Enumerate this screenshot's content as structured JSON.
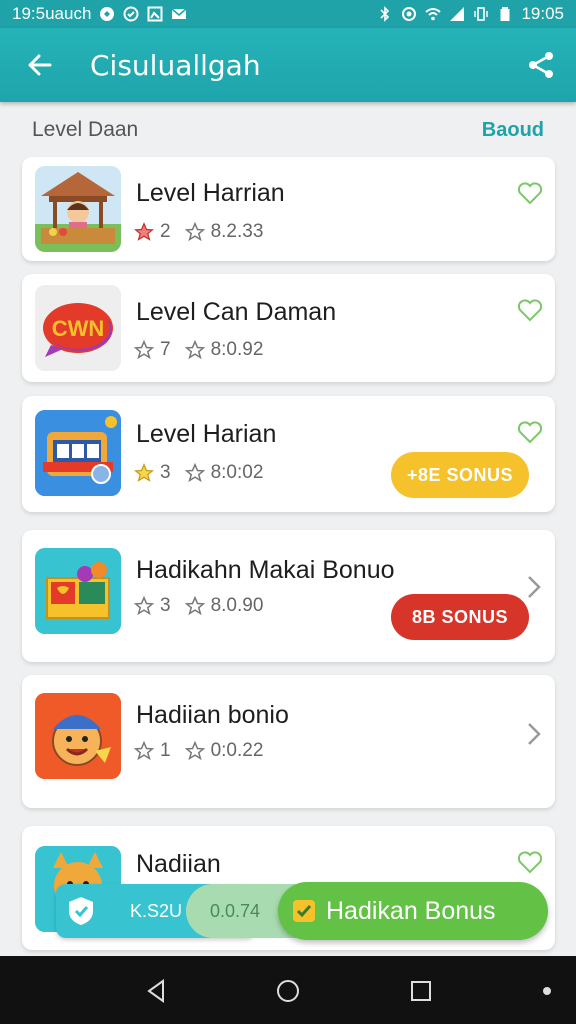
{
  "status_bar": {
    "time_left": "19:5uauch",
    "time_right": "19:05"
  },
  "app_bar": {
    "title": "Cisuluallgah",
    "back_icon": "arrow-back-icon",
    "share_icon": "share-icon"
  },
  "section": {
    "label": "Level Daan",
    "action": "Baoud"
  },
  "items": [
    {
      "name": "Level Harrian",
      "stars": "2",
      "value": "8.2.33",
      "action_icon": "heart-icon",
      "badge": "",
      "thumb_bg": "#d7e9f7"
    },
    {
      "name": "Level Can Daman",
      "stars": "7",
      "value": "8:0.92",
      "action_icon": "heart-icon",
      "badge": "",
      "thumb_bg": "#eeeeee",
      "logo_text": "CWN"
    },
    {
      "name": "Level Harian",
      "stars": "3",
      "value": "8:0:02",
      "action_icon": "heart-icon",
      "badge": "+8E SONUS",
      "thumb_bg": "#3b8fe0"
    },
    {
      "name": "Hadikahn Makai Bonuo",
      "stars": "3",
      "value": "8.0.90",
      "action_icon": "chevron-right-icon",
      "badge": "8B SONUS",
      "thumb_bg": "#38c3d0"
    },
    {
      "name": "Hadiian bonio",
      "stars": "1",
      "value": "0:0.22",
      "action_icon": "chevron-right-icon",
      "badge": "",
      "thumb_bg": "#f05a28"
    },
    {
      "name": "Nadiian",
      "stars": "",
      "value": "",
      "action_icon": "heart-icon",
      "badge": "",
      "thumb_bg": "#38c3d0"
    }
  ],
  "floating": {
    "blue_label": "K.S2U",
    "mid_label": "0.0.74",
    "green_label": "Hadikan Bonus"
  },
  "colors": {
    "primary": "#1fa3a8",
    "accent_green": "#63c246",
    "badge_yellow": "#f6c22c",
    "badge_red": "#d8352a",
    "heart": "#7cc86a"
  }
}
